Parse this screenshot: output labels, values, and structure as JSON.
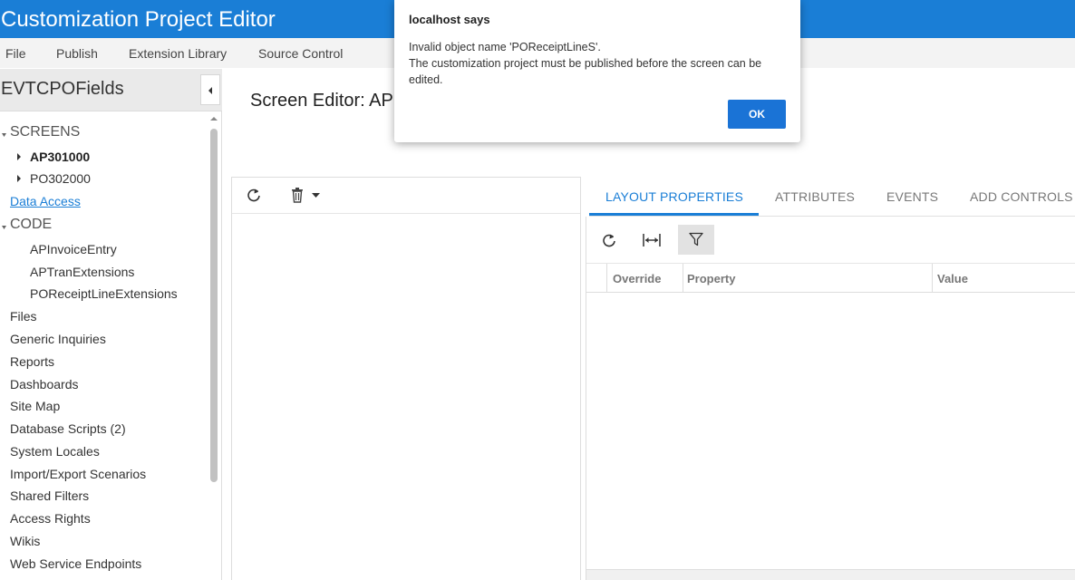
{
  "app": {
    "title": "Customization Project Editor"
  },
  "menu": [
    "File",
    "Publish",
    "Extension Library",
    "Source Control"
  ],
  "project": {
    "name": "EVTCPOFields"
  },
  "tree": {
    "screens_label": "SCREENS",
    "screens": [
      "AP301000",
      "PO302000"
    ],
    "data_access": "Data Access",
    "code_label": "CODE",
    "code_items": [
      "APInvoiceEntry",
      "APTranExtensions",
      "POReceiptLineExtensions"
    ],
    "items": [
      "Files",
      "Generic Inquiries",
      "Reports",
      "Dashboards",
      "Site Map",
      "Database Scripts (2)",
      "System Locales",
      "Import/Export Scenarios",
      "Shared Filters",
      "Access Rights",
      "Wikis",
      "Web Service Endpoints"
    ]
  },
  "screen_editor": {
    "title": "Screen Editor: AP"
  },
  "tabs": [
    "LAYOUT PROPERTIES",
    "ATTRIBUTES",
    "EVENTS",
    "ADD CONTROLS"
  ],
  "grid": {
    "columns": [
      "Override",
      "Property",
      "Value"
    ]
  },
  "dialog": {
    "title": "localhost says",
    "line1": "Invalid object name 'POReceiptLineS'.",
    "line2": "The customization project must be published before the screen can be edited.",
    "ok": "OK"
  },
  "colors": {
    "accent": "#1a7ed6",
    "button": "#1a73d6"
  },
  "icons": [
    "refresh-icon",
    "trash-icon",
    "caret-down-icon",
    "fit-width-icon",
    "filter-icon",
    "chevron-left-icon",
    "tree-expand-icon"
  ]
}
